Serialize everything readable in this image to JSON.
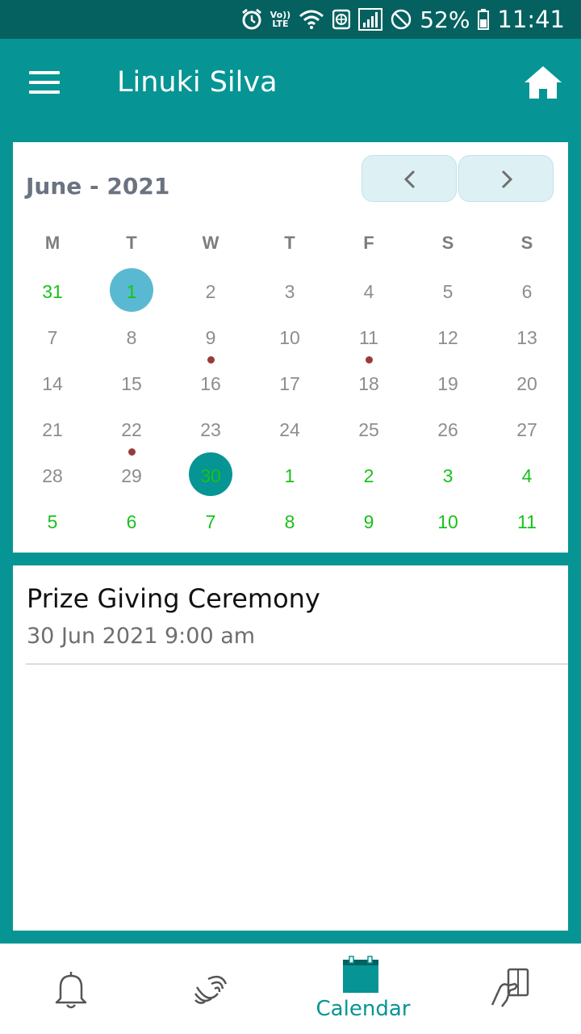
{
  "status_bar": {
    "battery_percent": "52%",
    "time": "11:41",
    "volte_top": "Vo))",
    "volte_bottom": "LTE",
    "icons": [
      "alarm-icon",
      "volte-icon",
      "wifi-icon",
      "data-saver-icon",
      "signal-icon",
      "do-not-disturb-icon",
      "battery-icon"
    ]
  },
  "app_bar": {
    "title": "Linuki Silva",
    "menu_icon": "hamburger-menu-icon",
    "home_icon": "home-icon"
  },
  "calendar": {
    "month_label": "June - 2021",
    "prev_icon": "chevron-left-icon",
    "next_icon": "chevron-right-icon",
    "weekdays": [
      "M",
      "T",
      "W",
      "T",
      "F",
      "S",
      "S"
    ],
    "weeks": [
      [
        {
          "d": "31",
          "other": true
        },
        {
          "d": "1",
          "today": true,
          "other": true
        },
        {
          "d": "2"
        },
        {
          "d": "3"
        },
        {
          "d": "4"
        },
        {
          "d": "5"
        },
        {
          "d": "6"
        }
      ],
      [
        {
          "d": "7"
        },
        {
          "d": "8"
        },
        {
          "d": "9",
          "event": true
        },
        {
          "d": "10"
        },
        {
          "d": "11",
          "event": true
        },
        {
          "d": "12"
        },
        {
          "d": "13"
        }
      ],
      [
        {
          "d": "14"
        },
        {
          "d": "15"
        },
        {
          "d": "16"
        },
        {
          "d": "17"
        },
        {
          "d": "18"
        },
        {
          "d": "19"
        },
        {
          "d": "20"
        }
      ],
      [
        {
          "d": "21"
        },
        {
          "d": "22",
          "event": true
        },
        {
          "d": "23"
        },
        {
          "d": "24"
        },
        {
          "d": "25"
        },
        {
          "d": "26"
        },
        {
          "d": "27"
        }
      ],
      [
        {
          "d": "28"
        },
        {
          "d": "29"
        },
        {
          "d": "30",
          "selected": true,
          "other": true
        },
        {
          "d": "1",
          "other": true
        },
        {
          "d": "2",
          "other": true
        },
        {
          "d": "3",
          "other": true
        },
        {
          "d": "4",
          "other": true
        }
      ],
      [
        {
          "d": "5",
          "other": true
        },
        {
          "d": "6",
          "other": true
        },
        {
          "d": "7",
          "other": true
        },
        {
          "d": "8",
          "other": true
        },
        {
          "d": "9",
          "other": true
        },
        {
          "d": "10",
          "other": true
        },
        {
          "d": "11",
          "other": true
        }
      ]
    ],
    "colors": {
      "today_circle": "#5ab9d2",
      "selected_circle": "#069594",
      "highlight_text": "#19c219",
      "event_dot": "#9b3a3a"
    }
  },
  "event": {
    "title": "Prize Giving Ceremony",
    "datetime": "30 Jun 2021 9:00 am"
  },
  "bottom_nav": {
    "items": [
      {
        "icon": "bell-icon",
        "label": ""
      },
      {
        "icon": "contactless-icon",
        "label": ""
      },
      {
        "icon": "calendar-icon",
        "label": "Calendar",
        "active": true
      },
      {
        "icon": "card-tap-icon",
        "label": ""
      }
    ]
  },
  "colors": {
    "primary": "#069594",
    "status_bar": "#05615f",
    "nav_button_bg": "#ddf1f5"
  }
}
